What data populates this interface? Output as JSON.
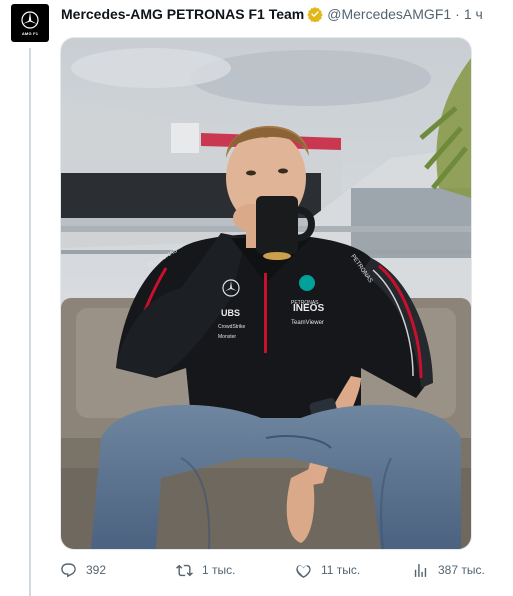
{
  "tweet": {
    "author_name": "Mercedes-AMG PETRONAS F1 Team",
    "author_handle": "@MercedesAMGF1",
    "separator": "·",
    "time": "1 ч",
    "avatar_text": "AMG F1",
    "verified_color": "#e2b719"
  },
  "photo": {
    "sleeve_brand": "PETRONAS",
    "jacket_texts": [
      "PETRONAS",
      "INEOS",
      "TeamViewer",
      "UBS",
      "CrowdStrike",
      "Monster"
    ]
  },
  "actions": {
    "replies": "392",
    "retweets": "1 тыс.",
    "likes": "11 тыс.",
    "views": "387 тыс.",
    "icons": [
      "reply-icon",
      "retweet-icon",
      "like-icon",
      "views-icon"
    ]
  }
}
